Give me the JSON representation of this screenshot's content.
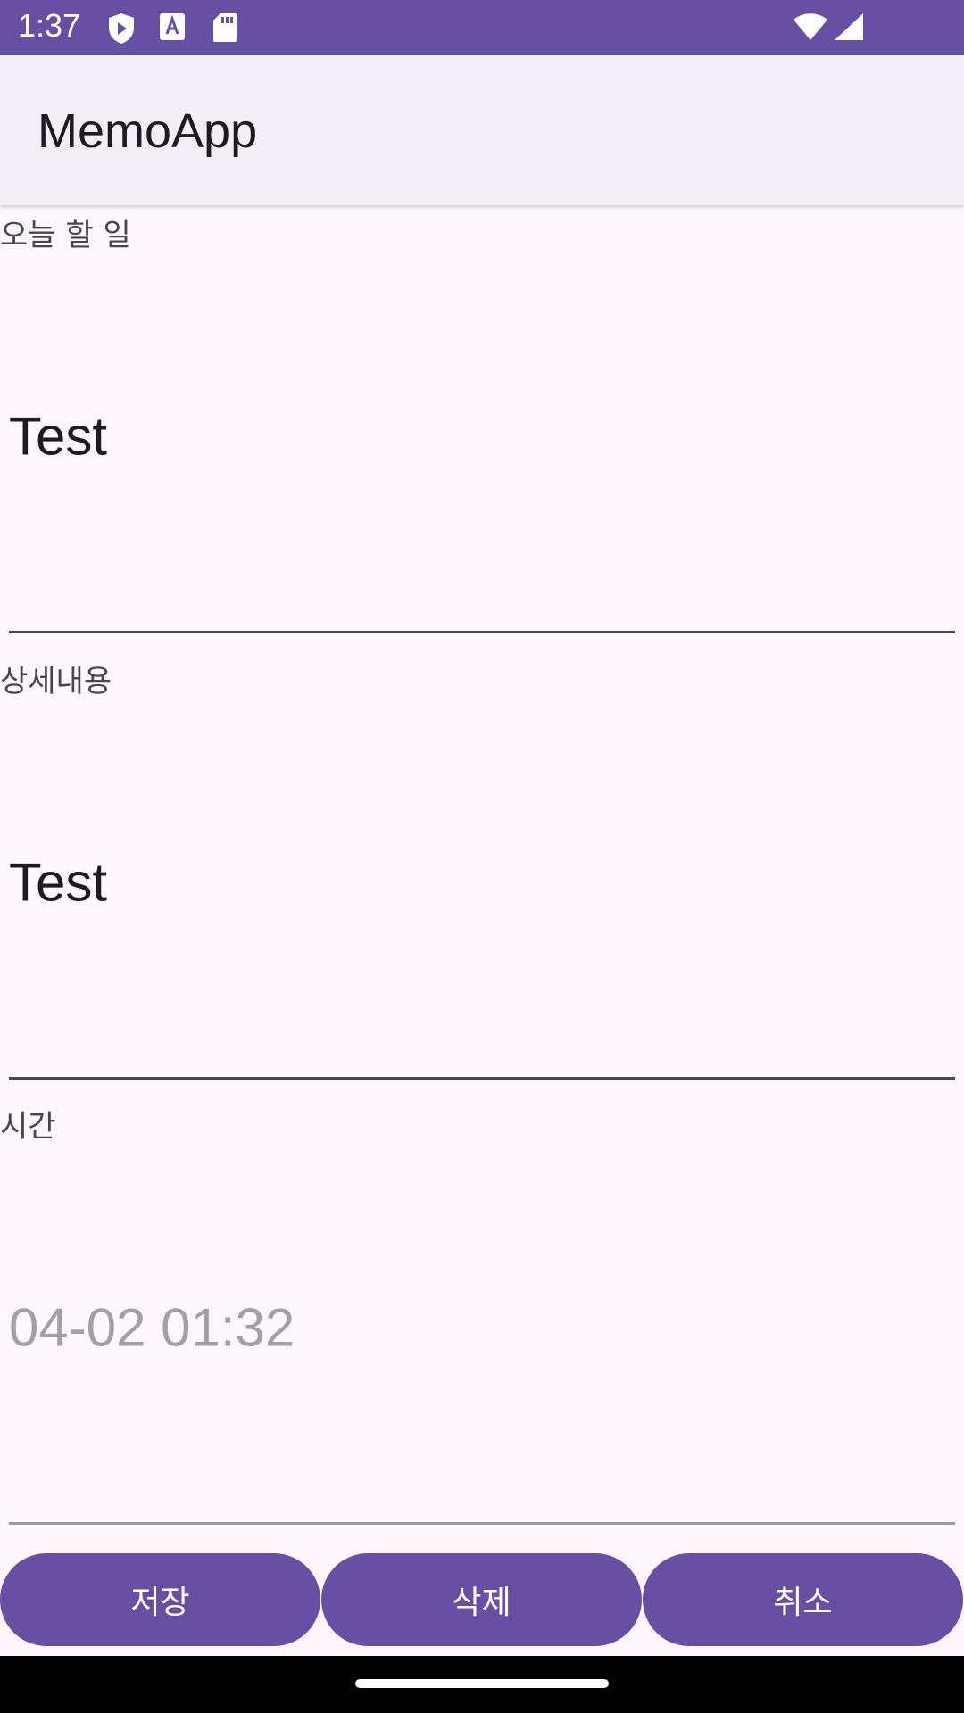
{
  "status_bar": {
    "time": "1:37",
    "icons": [
      "play-protect-icon",
      "font-a-icon",
      "sd-card-icon",
      "wifi-icon",
      "signal-icon"
    ]
  },
  "app_bar": {
    "title": "MemoApp"
  },
  "form": {
    "todo": {
      "label": "오늘 할 일",
      "value": "Test"
    },
    "detail": {
      "label": "상세내용",
      "value": "Test"
    },
    "time": {
      "label": "시간",
      "value": "04-02 01:32"
    }
  },
  "buttons": {
    "save": "저장",
    "delete": "삭제",
    "cancel": "취소"
  },
  "colors": {
    "primary": "#6750a4",
    "app_bar_bg": "#f2eef6",
    "background": "#fdf7fd",
    "text": "#1d1b20",
    "hint_text": "#a39ea8"
  }
}
